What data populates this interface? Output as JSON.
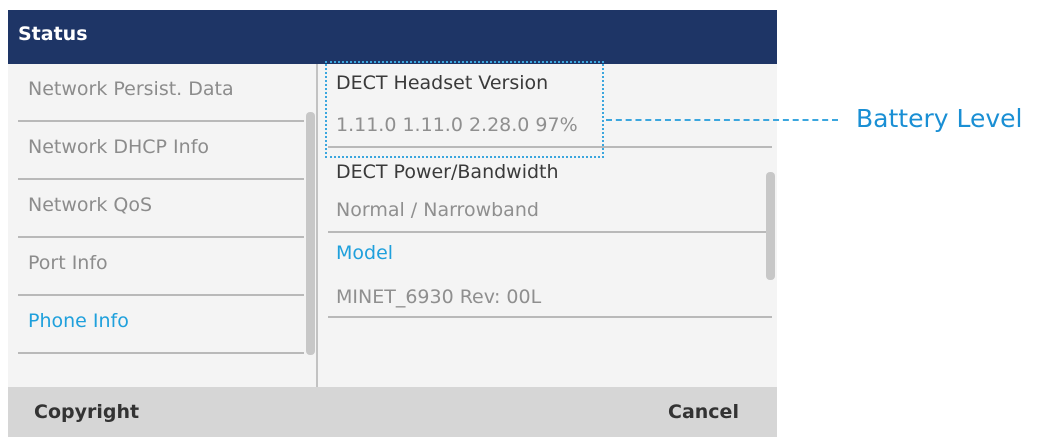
{
  "title": "Status",
  "left_menu": {
    "items": [
      {
        "label": "Network Persist. Data",
        "active": false
      },
      {
        "label": "Network DHCP Info",
        "active": false
      },
      {
        "label": "Network QoS",
        "active": false
      },
      {
        "label": "Port Info",
        "active": false
      },
      {
        "label": "Phone Info",
        "active": true
      }
    ]
  },
  "details": {
    "dect_headset_version_label": "DECT Headset Version",
    "dect_headset_version_value": "1.11.0 1.11.0 2.28.0 97%",
    "dect_power_label": "DECT Power/Bandwidth",
    "dect_power_value": "Normal / Narrowband",
    "model_label": "Model",
    "model_value": "MINET_6930 Rev: 00L"
  },
  "softkeys": {
    "left": "Copyright",
    "right": "Cancel"
  },
  "callout": {
    "label": "Battery Level"
  },
  "colors": {
    "title_bar": "#1e3566",
    "accent": "#1fa0dc",
    "callout": "#3ba6de"
  }
}
